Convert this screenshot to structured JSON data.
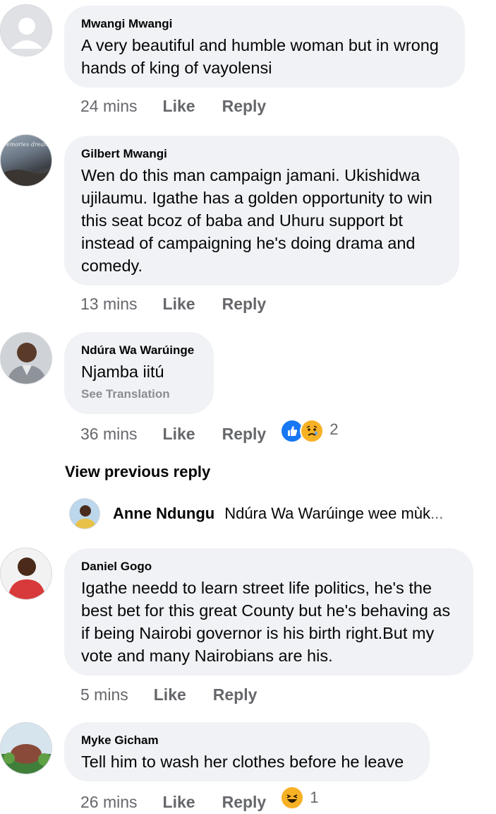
{
  "comments": [
    {
      "author": "Mwangi Mwangi",
      "text": "A very beautiful and humble woman but in wrong hands of king of vayolensi",
      "time": "24 mins",
      "like": "Like",
      "reply": "Reply"
    },
    {
      "author": "Gilbert Mwangi",
      "text": "Wen do this man campaign jamani. Ukishidwa ujilaumu. Igathe has a golden opportunity to win this seat bcoz of baba and Uhuru support bt instead of campaigning he's doing drama and comedy.",
      "time": "13 mins",
      "like": "Like",
      "reply": "Reply"
    },
    {
      "author": "Ndúra Wa Warúinge",
      "text": "Njamba iitú",
      "translation": "See Translation",
      "time": "36 mins",
      "like": "Like",
      "reply": "Reply",
      "reaction_count": "2",
      "reactions": [
        "like-icon",
        "care-sad-icon"
      ]
    },
    {
      "author": "Daniel Gogo",
      "text": "Igathe needd to learn street life politics, he's the best bet for this great County but he's behaving as if being Nairobi governor is his birth right.But my vote and many Nairobians are his.",
      "time": "5 mins",
      "like": "Like",
      "reply": "Reply"
    },
    {
      "author": "Myke Gicham",
      "text": "Tell him to wash her clothes before he leave",
      "time": "26 mins",
      "like": "Like",
      "reply": "Reply",
      "reaction_count": "1",
      "reactions": [
        "haha-icon"
      ]
    }
  ],
  "view_previous_reply": "View previous reply",
  "collapsed_reply": {
    "author": "Anne Ndungu",
    "text": "Ndúra Wa Warúinge wee  mùk",
    "ellipsis": "..."
  },
  "avatar_overlay_text": "emories dreams take us forward",
  "colors": {
    "bubble": "#f0f2f5",
    "meta": "#65676b",
    "like_blue": "#1877f2",
    "sad_yellow": "#f7b125"
  }
}
